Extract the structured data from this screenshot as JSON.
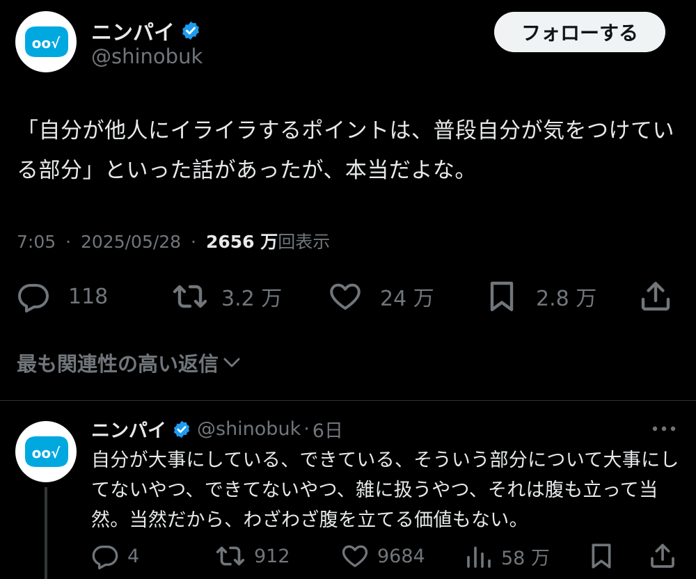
{
  "main_tweet": {
    "author": {
      "name": "ニンパイ",
      "handle": "@shinobuk",
      "verified": true,
      "avatar_text": "oo√",
      "avatar_color": "#00a8e0"
    },
    "follow_label": "フォローする",
    "text": "「自分が他人にイライラするポイントは、普段自分が気をつけている部分」といった話があったが、本当だよな。",
    "time": "7:05",
    "date": "2025/05/28",
    "views_count": "2656 万",
    "views_label": "回表示",
    "separator": "·",
    "actions": {
      "replies": "118",
      "reposts": "3.2 万",
      "likes": "24 万",
      "bookmarks": "2.8 万"
    }
  },
  "replies_sort": {
    "label": "最も関連性の高い返信"
  },
  "reply": {
    "author": {
      "name": "ニンパイ",
      "handle": "@shinobuk",
      "verified": true
    },
    "age": "6日",
    "text": "自分が大事にしている、できている、そういう部分について大事にしてないやつ、できてないやつ、雑に扱うやつ、それは腹も立って当然。当然だから、わざわざ腹を立てる価値もない。",
    "actions": {
      "replies": "4",
      "reposts": "912",
      "likes": "9684",
      "views": "58 万"
    }
  },
  "colors": {
    "background": "#000000",
    "text_primary": "#e7e9ea",
    "text_secondary": "#71767b",
    "verified_blue": "#1d9bf0",
    "divider": "#2f3336"
  }
}
